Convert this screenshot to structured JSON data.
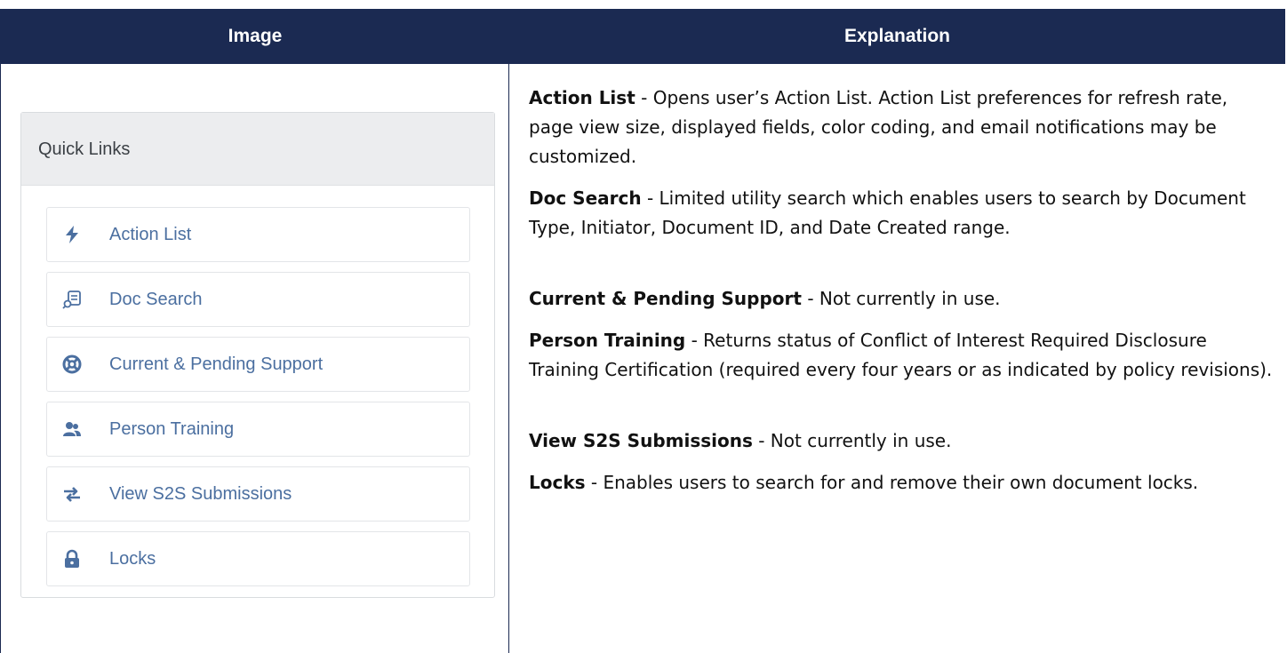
{
  "table": {
    "header_image": "Image",
    "header_explanation": "Explanation"
  },
  "panel": {
    "title": "Quick Links",
    "items": [
      {
        "label": "Action List",
        "icon": "bolt-icon"
      },
      {
        "label": "Doc Search",
        "icon": "doc-search-icon"
      },
      {
        "label": "Current & Pending Support",
        "icon": "life-ring-icon"
      },
      {
        "label": "Person Training",
        "icon": "users-icon"
      },
      {
        "label": "View S2S Submissions",
        "icon": "exchange-icon"
      },
      {
        "label": "Locks",
        "icon": "lock-icon"
      }
    ],
    "icon_color": "#4b6fa0",
    "header_bg": "#ecedef"
  },
  "explanations": [
    {
      "term": "Action List",
      "text": " - Opens user’s Action List. Action List preferences for refresh rate, page view size, displayed fields, color coding, and email notifications may be customized."
    },
    {
      "term": "Doc Search",
      "text": " - Limited utility search which enables users to search by Document Type, Initiator, Document ID, and Date Created range."
    },
    {
      "term": "Current & Pending Support",
      "text": " - Not currently in use."
    },
    {
      "term": "Person Training",
      "text": " - Returns status of Conflict of Interest Required Disclosure Training Certification (required every four years or as indicated by policy revisions)."
    },
    {
      "term": "View S2S Submissions",
      "text": " - Not currently in use."
    },
    {
      "term": "Locks",
      "text": " - Enables users to search for and remove their own document locks."
    }
  ],
  "colors": {
    "header_bg": "#1b2a52",
    "link_text": "#4b6fa0"
  }
}
